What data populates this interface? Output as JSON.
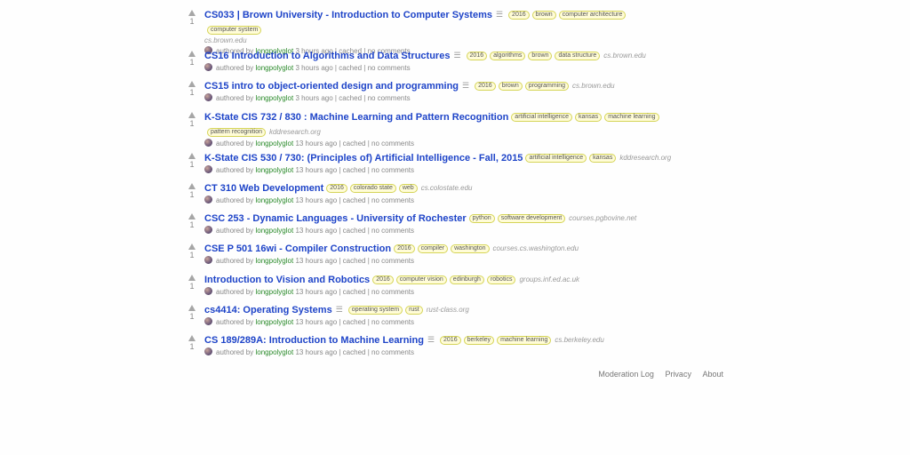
{
  "stories": [
    {
      "title": "CS033 | Brown University - Introduction to Computer Systems",
      "has_description": true,
      "tags": [
        "2016",
        "brown",
        "computer architecture",
        "computer system"
      ],
      "domain": "cs.brown.edu",
      "domain_block": true,
      "score": "1",
      "author_prefix": "authored by",
      "author": "longpolyglot",
      "time": "3 hours ago",
      "cached": "cached",
      "comments": "no comments"
    },
    {
      "title": "CS16 Introduction to Algorithms and Data Structures",
      "has_description": true,
      "tags": [
        "2016",
        "algorithms",
        "brown",
        "data structure"
      ],
      "domain": "cs.brown.edu",
      "domain_block": false,
      "score": "1",
      "author_prefix": "authored by",
      "author": "longpolyglot",
      "time": "3 hours ago",
      "cached": "cached",
      "comments": "no comments"
    },
    {
      "title": "CS15 intro to object-oriented design and programming",
      "has_description": true,
      "tags": [
        "2016",
        "brown",
        "programming"
      ],
      "domain": "cs.brown.edu",
      "domain_block": false,
      "score": "1",
      "author_prefix": "authored by",
      "author": "longpolyglot",
      "time": "3 hours ago",
      "cached": "cached",
      "comments": "no comments"
    },
    {
      "title": "K-State CIS 732 / 830 : Machine Learning and Pattern Recognition",
      "has_description": false,
      "tags": [
        "artificial intelligence",
        "kansas",
        "machine learning",
        "pattern recognition"
      ],
      "domain": "kddresearch.org",
      "domain_block": false,
      "score": "1",
      "author_prefix": "authored by",
      "author": "longpolyglot",
      "time": "13 hours ago",
      "cached": "cached",
      "comments": "no comments"
    },
    {
      "title": "K-State CIS 530 / 730: (Principles of) Artificial Intelligence - Fall, 2015",
      "has_description": false,
      "tags": [
        "artificial intelligence",
        "kansas"
      ],
      "domain": "kddresearch.org",
      "domain_block": false,
      "score": "1",
      "author_prefix": "authored by",
      "author": "longpolyglot",
      "time": "13 hours ago",
      "cached": "cached",
      "comments": "no comments"
    },
    {
      "title": "CT 310 Web Development",
      "has_description": false,
      "tags": [
        "2016",
        "colorado state",
        "web"
      ],
      "domain": "cs.colostate.edu",
      "domain_block": false,
      "score": "1",
      "author_prefix": "authored by",
      "author": "longpolyglot",
      "time": "13 hours ago",
      "cached": "cached",
      "comments": "no comments"
    },
    {
      "title": "CSC 253 - Dynamic Languages - University of Rochester",
      "has_description": false,
      "tags": [
        "python",
        "software development"
      ],
      "domain": "courses.pgbovine.net",
      "domain_block": false,
      "score": "1",
      "author_prefix": "authored by",
      "author": "longpolyglot",
      "time": "13 hours ago",
      "cached": "cached",
      "comments": "no comments"
    },
    {
      "title": "CSE P 501 16wi - Compiler Construction",
      "has_description": false,
      "tags": [
        "2016",
        "compiler",
        "washington"
      ],
      "domain": "courses.cs.washington.edu",
      "domain_block": false,
      "score": "1",
      "author_prefix": "authored by",
      "author": "longpolyglot",
      "time": "13 hours ago",
      "cached": "cached",
      "comments": "no comments"
    },
    {
      "title": "Introduction to Vision and Robotics",
      "has_description": false,
      "tags": [
        "2016",
        "computer vision",
        "edinburgh",
        "robotics"
      ],
      "domain": "groups.inf.ed.ac.uk",
      "domain_block": false,
      "score": "1",
      "author_prefix": "authored by",
      "author": "longpolyglot",
      "time": "13 hours ago",
      "cached": "cached",
      "comments": "no comments"
    },
    {
      "title": "cs4414: Operating Systems",
      "has_description": true,
      "tags": [
        "operating system",
        "rust"
      ],
      "domain": "rust-class.org",
      "domain_block": false,
      "score": "1",
      "author_prefix": "authored by",
      "author": "longpolyglot",
      "time": "13 hours ago",
      "cached": "cached",
      "comments": "no comments"
    },
    {
      "title": "CS 189/289A: Introduction to Machine Learning",
      "has_description": true,
      "tags": [
        "2016",
        "berkeley",
        "machine learning"
      ],
      "domain": "cs.berkeley.edu",
      "domain_block": false,
      "score": "1",
      "author_prefix": "authored by",
      "author": "longpolyglot",
      "time": "13 hours ago",
      "cached": "cached",
      "comments": "no comments"
    }
  ],
  "footer": {
    "moderation_log": "Moderation Log",
    "privacy": "Privacy",
    "about": "About"
  },
  "icons": {
    "upvote": "triangle-up",
    "description": "description-lines"
  },
  "colors": {
    "title_link": "#1e44c8",
    "author": "#2a8a2a",
    "tag_bg": "#fffcd7",
    "tag_border": "#d5d458"
  }
}
